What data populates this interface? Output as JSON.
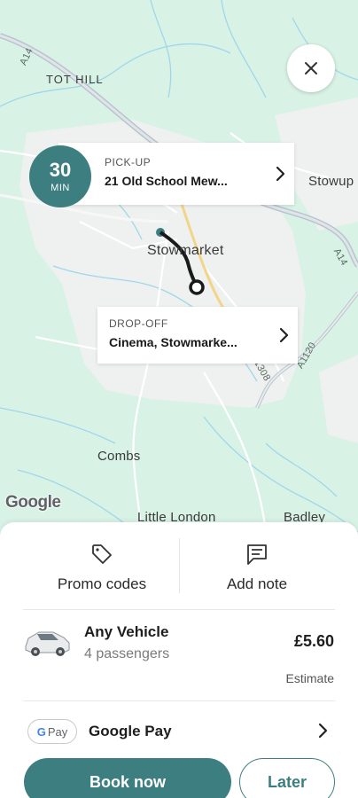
{
  "map": {
    "place_labels": {
      "tot_hill": "TOT HILL",
      "stowmarket": "Stowmarket",
      "stowup": "Stowup",
      "combs": "Combs",
      "little_london": "Little London",
      "badley": "Badley"
    },
    "road_labels": {
      "a14_left": "A14",
      "a14_right": "A14",
      "a1120": "A1120",
      "b1308": "1308"
    },
    "attribution": "Google"
  },
  "eta": {
    "value": "30",
    "unit": "MIN"
  },
  "pickup": {
    "caption": "PICK-UP",
    "address": "21 Old School Mew..."
  },
  "dropoff": {
    "caption": "DROP-OFF",
    "address": "Cinema, Stowmarke..."
  },
  "actions": {
    "promo_label": "Promo codes",
    "note_label": "Add note"
  },
  "vehicle": {
    "name": "Any Vehicle",
    "passengers": "4 passengers",
    "price": "£5.60",
    "price_note": "Estimate"
  },
  "payment": {
    "badge": "Pay",
    "badge_g": "G",
    "method": "Google Pay"
  },
  "buttons": {
    "book": "Book now",
    "later": "Later"
  },
  "colors": {
    "accent": "#3d7f81",
    "map_bg": "#d9f2e6",
    "map_urban": "#eef1ef",
    "route": "#1a1a1a"
  },
  "icons": {
    "close": "close-icon",
    "chevron": "chevron-right-icon",
    "promo": "tag-icon",
    "note": "message-icon",
    "vehicle": "car-icon"
  }
}
